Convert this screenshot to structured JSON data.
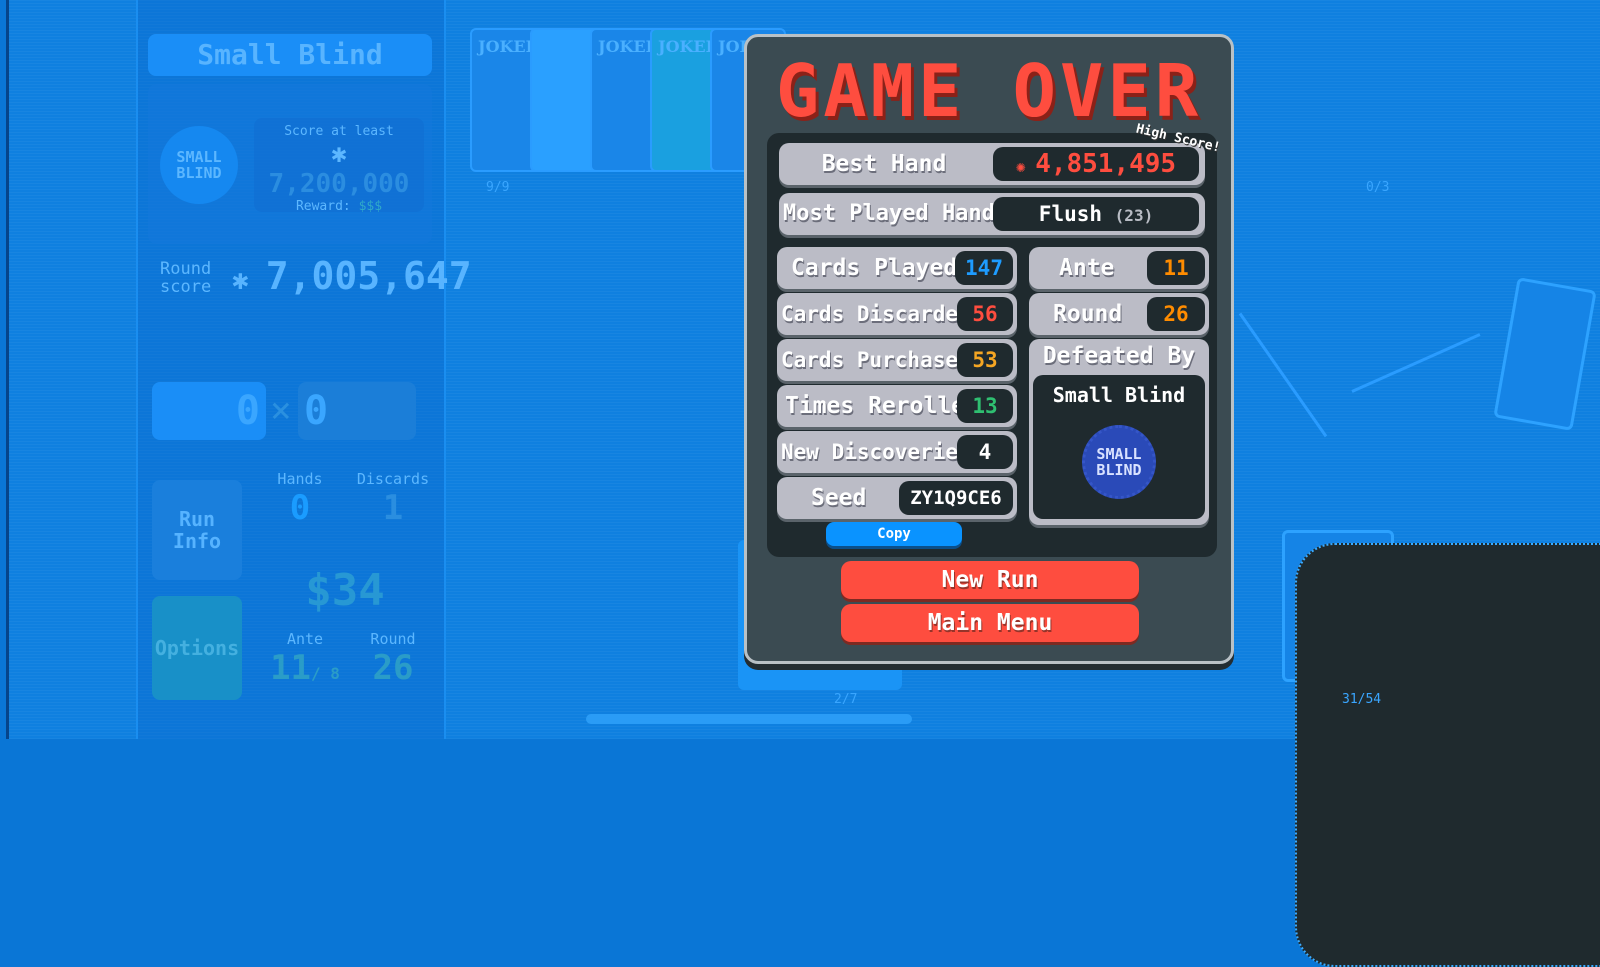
{
  "sidebar": {
    "blind_name": "Small Blind",
    "blind_chip_label": "SMALL BLIND",
    "score_at_least_label": "Score at least",
    "score_target": "7,200,000",
    "reward_label": "Reward:",
    "reward_value": "$$$",
    "round_score_label": "Round score",
    "round_score": "7,005,647",
    "chips": "0",
    "mult_symbol": "×",
    "mult": "0",
    "run_info_label": "Run Info",
    "options_label": "Options",
    "hands_label": "Hands",
    "hands_value": "0",
    "discards_label": "Discards",
    "discards_value": "1",
    "money": "$34",
    "ante_label": "Ante",
    "ante_value": "11",
    "ante_max": "/ 8",
    "round_label": "Round",
    "round_value": "26"
  },
  "board": {
    "joker_card_label": "JOKER",
    "joker_count": "9/9",
    "consumable_count": "0/3",
    "hand_count": "2/7",
    "deck_count": "31/54"
  },
  "game_over": {
    "title": "GAME OVER",
    "high_score_badge": "High Score!",
    "best_hand_label": "Best Hand",
    "best_hand_value": "4,851,495",
    "most_played_label": "Most Played Hand",
    "most_played_value": "Flush",
    "most_played_count": "(23)",
    "stats": [
      {
        "label": "Cards Played",
        "value": "147",
        "color": "#1e9cff"
      },
      {
        "label": "Cards Discarded",
        "value": "56",
        "color": "#fe4d3f"
      },
      {
        "label": "Cards Purchased",
        "value": "53",
        "color": "#f5a623"
      },
      {
        "label": "Times Rerolled",
        "value": "13",
        "color": "#2fbf71"
      },
      {
        "label": "New Discoveries",
        "value": "4",
        "color": "#ffffff"
      },
      {
        "label": "Seed",
        "value": "ZY1Q9CE6",
        "color": "#ffffff"
      }
    ],
    "ante_label": "Ante",
    "ante_value": "11",
    "round_label": "Round",
    "round_value": "26",
    "defeated_by_label": "Defeated By",
    "defeated_by_name": "Small Blind",
    "defeated_chip_label": "SMALL BLIND",
    "copy_label": "Copy",
    "new_run_label": "New Run",
    "main_menu_label": "Main Menu",
    "colors": {
      "accent_red": "#fe4d3f",
      "accent_orange": "#ff8c00",
      "copy_blue": "#0a93ff"
    }
  }
}
